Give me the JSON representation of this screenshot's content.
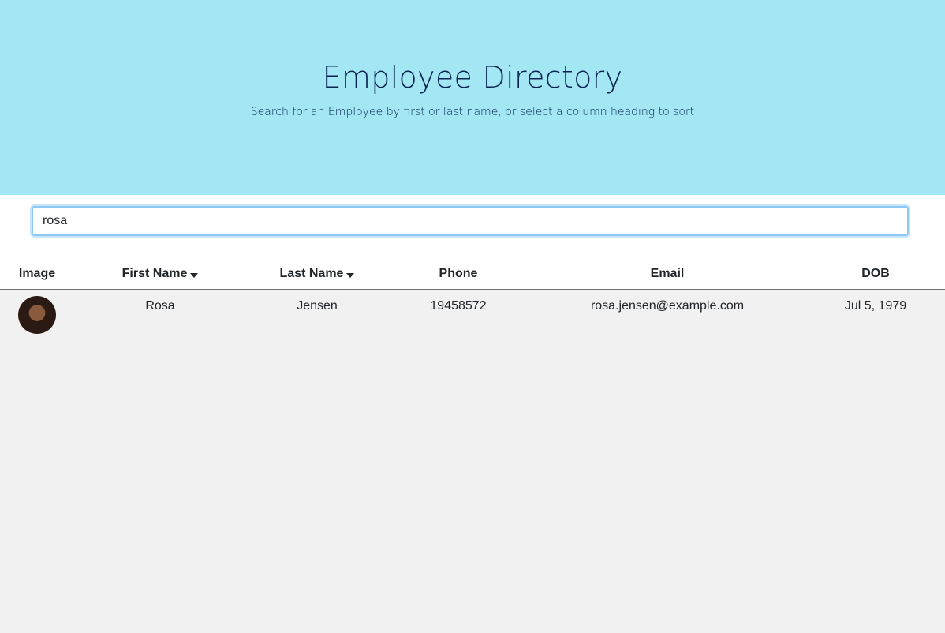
{
  "header": {
    "title": "Employee Directory",
    "subtitle": "Search for an Employee by first or last name, or select a column heading to sort"
  },
  "search": {
    "value": "rosa",
    "placeholder": ""
  },
  "table": {
    "columns": {
      "image": "Image",
      "first_name": "First Name",
      "last_name": "Last Name",
      "phone": "Phone",
      "email": "Email",
      "dob": "DOB"
    },
    "rows": [
      {
        "avatar_icon": "employee-photo",
        "first_name": "Rosa",
        "last_name": "Jensen",
        "phone": "19458572",
        "email": "rosa.jensen@example.com",
        "dob": "Jul 5, 1979"
      }
    ]
  },
  "colors": {
    "header_background": "#a2e7f3",
    "title_text": "#0a2352",
    "page_background": "#f1f1f1"
  }
}
